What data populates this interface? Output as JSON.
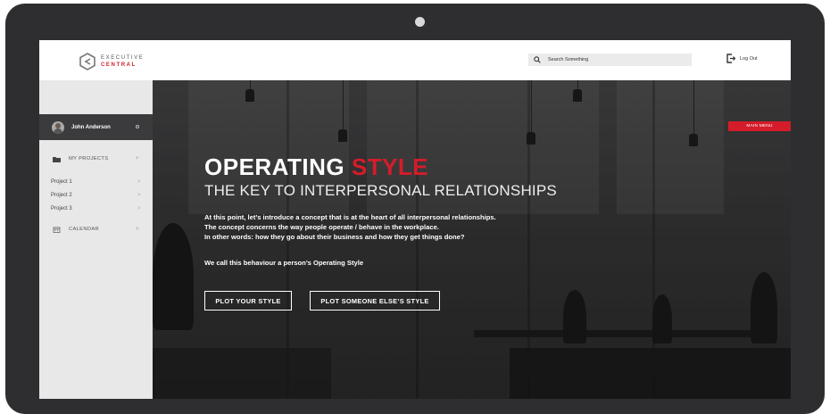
{
  "header": {
    "logo_line1": "EXECUTIVE",
    "logo_line2": "CENTRAL",
    "search_placeholder": "Search Something",
    "logout_label": "Log Out"
  },
  "sidebar": {
    "user_name": "John Anderson",
    "my_projects_label": "MY PROJECTS",
    "my_projects_action": "+",
    "projects": [
      {
        "label": "Project 1",
        "arrow": ">"
      },
      {
        "label": "Project 2",
        "arrow": ">"
      },
      {
        "label": "Project 3",
        "arrow": ">"
      }
    ],
    "calendar_label": "CALENDAR",
    "calendar_arrow": ">"
  },
  "hero": {
    "main_menu_label": "MAIN MENU",
    "title_main": "OPERATING ",
    "title_accent": "STYLE",
    "subtitle": "THE KEY TO INTERPERSONAL RELATIONSHIPS",
    "paragraph_lines": [
      "At this point, let’s introduce a concept that is at the heart of all interpersonal relationships.",
      "The concept concerns the way people operate / behave in the workplace.",
      "In other words: how they go about their business and how they get things done?"
    ],
    "paragraph2": "We call this behaviour a person’s Operating Style",
    "buttons": {
      "plot_your_style": "PLOT YOUR STYLE",
      "plot_someone_else": "PLOT SOMEONE ELSE’S STYLE"
    }
  },
  "colors": {
    "accent": "#d51c2a",
    "device_bezel": "#2e2e30",
    "sidebar_bg": "#e8e8e9",
    "user_bar_bg": "#3b3b3d"
  }
}
